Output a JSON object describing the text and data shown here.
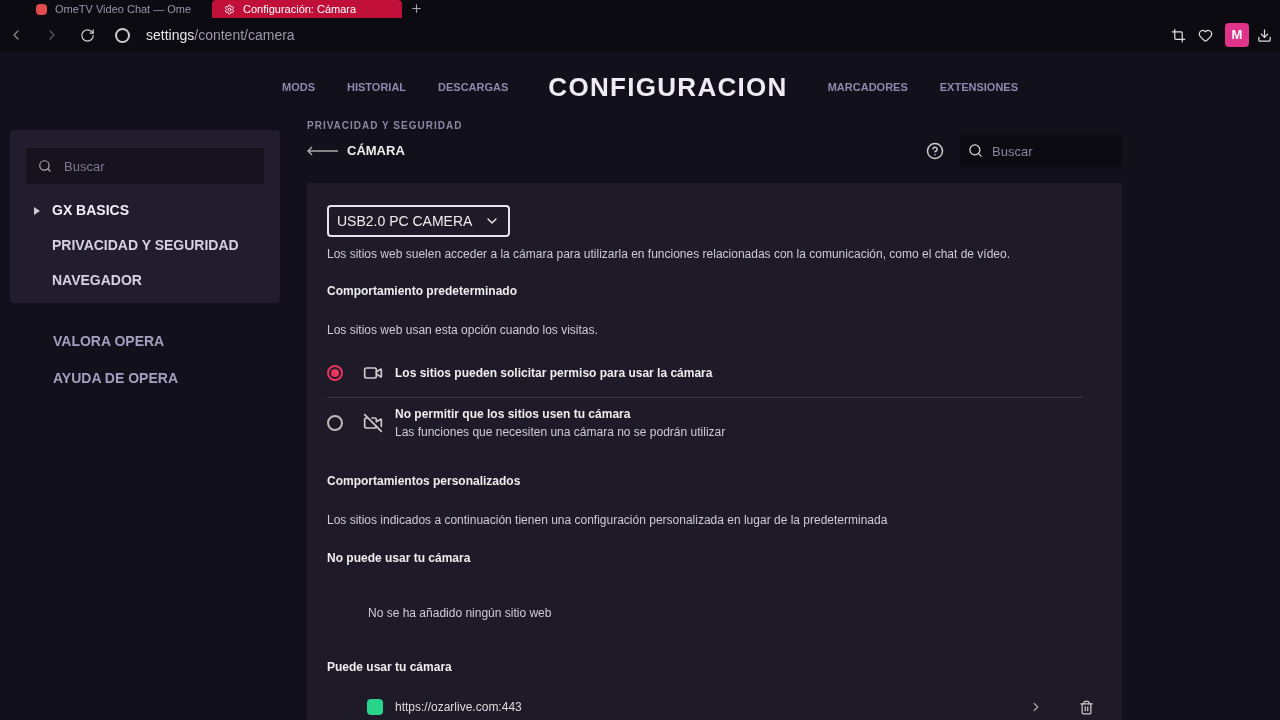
{
  "browser_tabs": [
    {
      "label": "OmeTV Video Chat — Ome",
      "selected": false
    },
    {
      "label": "Configuración: Cámara",
      "selected": true
    }
  ],
  "address": {
    "host": "settings",
    "path": "/content/camera"
  },
  "profile_initial": "M",
  "top_nav": {
    "left": [
      "MODS",
      "HISTORIAL",
      "DESCARGAS"
    ],
    "title": "CONFIGURACION",
    "right": [
      "MARCADORES",
      "EXTENSIONES"
    ]
  },
  "sidebar": {
    "search_placeholder": "Buscar",
    "items": [
      {
        "label": "GX BASICS",
        "selected": true
      },
      {
        "label": "PRIVACIDAD Y SEGURIDAD",
        "selected": false
      },
      {
        "label": "NAVEGADOR",
        "selected": false
      }
    ],
    "links": [
      "VALORA OPERA",
      "AYUDA DE OPERA"
    ]
  },
  "breadcrumb": "PRIVACIDAD Y SEGURIDAD",
  "page_title": "CÁMARA",
  "search_placeholder": "Buscar",
  "camera_select": "USB2.0 PC CAMERA",
  "intro": "Los sitios web suelen acceder a la cámara para utilizarla en funciones relacionadas con la comunicación, como el chat de vídeo.",
  "default_heading": "Comportamiento predeterminado",
  "default_note": "Los sitios web usan esta opción cuando los visitas.",
  "options": [
    {
      "label": "Los sitios pueden solicitar permiso para usar la cámara",
      "selected": true,
      "kind": "allow"
    },
    {
      "label": "No permitir que los sitios usen tu cámara",
      "sub": "Las funciones que necesiten una cámara no se podrán utilizar",
      "selected": false,
      "kind": "block"
    }
  ],
  "custom_heading": "Comportamientos personalizados",
  "custom_note": "Los sitios indicados a continuación tienen una configuración personalizada en lugar de la predeterminada",
  "blocked": {
    "heading": "No puede usar tu cámara",
    "empty": "No se ha añadido ningún sitio web"
  },
  "allowed": {
    "heading": "Puede usar tu cámara",
    "sites": [
      "https://ozarlive.com:443"
    ]
  }
}
